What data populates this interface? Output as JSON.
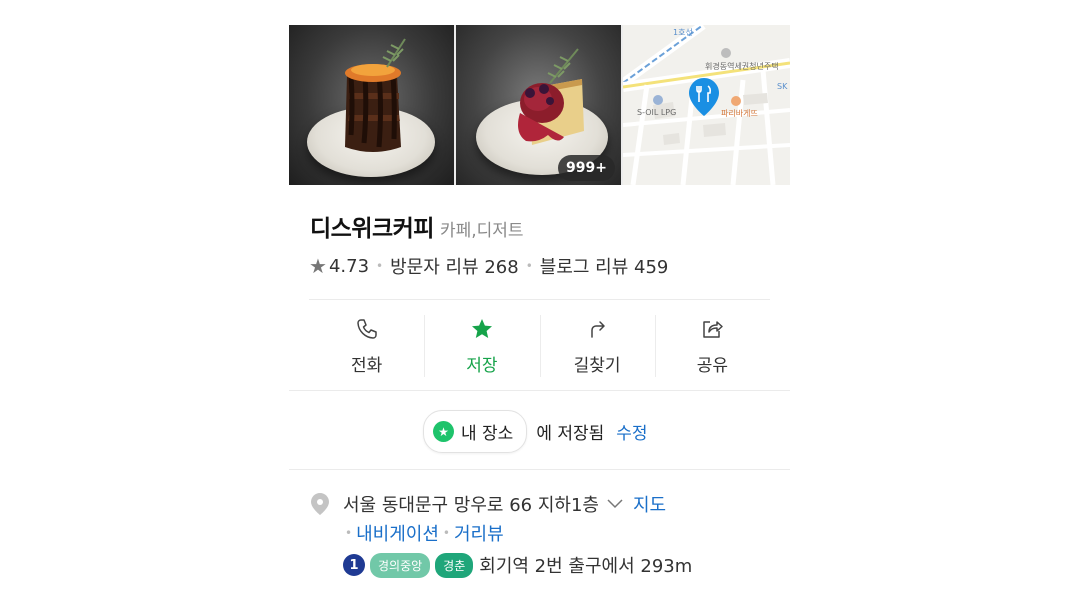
{
  "photos": {
    "count_badge": "999+"
  },
  "map_preview": {
    "labels": [
      "1호선",
      "휘경동역세권청년주택",
      "S-OIL LPG",
      "파리바게뜨",
      "SK"
    ]
  },
  "place": {
    "name": "디스위크커피",
    "category": "카페,디저트",
    "rating": "4.73",
    "visitor_reviews": "방문자 리뷰 268",
    "blog_reviews": "블로그 리뷰 459"
  },
  "actions": [
    {
      "label": "전화",
      "icon": "phone-icon"
    },
    {
      "label": "저장",
      "icon": "star-icon"
    },
    {
      "label": "길찾기",
      "icon": "directions-icon"
    },
    {
      "label": "공유",
      "icon": "share-icon"
    }
  ],
  "saved": {
    "chip_label": "내 장소",
    "suffix": "에 저장됨",
    "edit_label": "수정"
  },
  "address": {
    "text": "서울 동대문구 망우로 66 지하1층",
    "map_link": "지도",
    "navigation_link": "내비게이션",
    "street_view_link": "거리뷰"
  },
  "transit": {
    "line_number": "1",
    "badge_1": "경의중앙",
    "badge_2": "경춘",
    "text": "회기역 2번 출구에서 293m"
  },
  "colors": {
    "accent_green": "#16a34a",
    "link_blue": "#1a6fc9",
    "line1_blue": "#1f3a93",
    "gyeongui_green": "#71c8a8",
    "gyeongchun_green": "#1fa67a"
  }
}
